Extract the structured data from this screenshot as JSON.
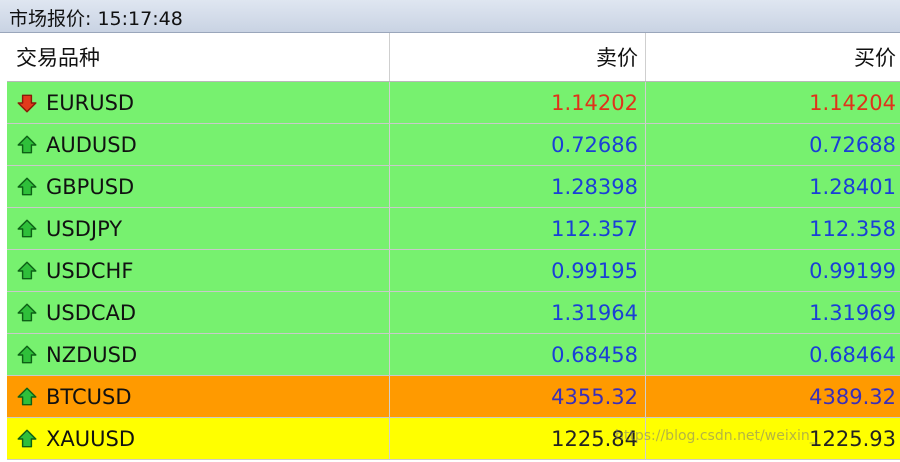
{
  "window": {
    "title_label": "市场报价:",
    "title_time": "15:17:48"
  },
  "table": {
    "headers": {
      "symbol": "交易品种",
      "bid": "卖价",
      "ask": "买价"
    },
    "rows": [
      {
        "symbol": "EURUSD",
        "bid": "1.14202",
        "ask": "1.14204",
        "direction": "down",
        "bg": "#77f16f",
        "price_color": "#e0321a"
      },
      {
        "symbol": "AUDUSD",
        "bid": "0.72686",
        "ask": "0.72688",
        "direction": "up",
        "bg": "#77f16f",
        "price_color": "#1a3fd6"
      },
      {
        "symbol": "GBPUSD",
        "bid": "1.28398",
        "ask": "1.28401",
        "direction": "up",
        "bg": "#77f16f",
        "price_color": "#1a3fd6"
      },
      {
        "symbol": "USDJPY",
        "bid": "112.357",
        "ask": "112.358",
        "direction": "up",
        "bg": "#77f16f",
        "price_color": "#1a3fd6"
      },
      {
        "symbol": "USDCHF",
        "bid": "0.99195",
        "ask": "0.99199",
        "direction": "up",
        "bg": "#77f16f",
        "price_color": "#1a3fd6"
      },
      {
        "symbol": "USDCAD",
        "bid": "1.31964",
        "ask": "1.31969",
        "direction": "up",
        "bg": "#77f16f",
        "price_color": "#1a3fd6"
      },
      {
        "symbol": "NZDUSD",
        "bid": "0.68458",
        "ask": "0.68464",
        "direction": "up",
        "bg": "#77f16f",
        "price_color": "#1a3fd6"
      },
      {
        "symbol": "BTCUSD",
        "bid": "4355.32",
        "ask": "4389.32",
        "direction": "up",
        "bg": "#ff9a00",
        "price_color": "#3a2fb8"
      },
      {
        "symbol": "XAUUSD",
        "bid": "1225.84",
        "ask": "1225.93",
        "direction": "up",
        "bg": "#ffff00",
        "price_color": "#222222"
      }
    ]
  },
  "watermark": "https://blog.csdn.net/weixin_"
}
